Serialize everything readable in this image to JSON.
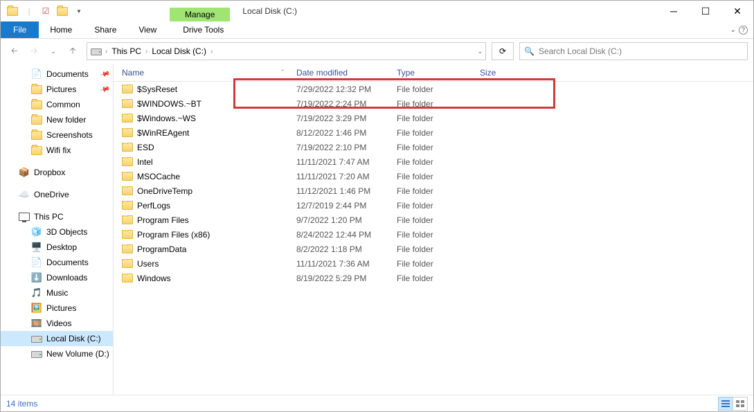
{
  "window": {
    "manage_tab": "Manage",
    "drive_tools": "Drive Tools",
    "title": "Local Disk (C:)"
  },
  "ribbon": {
    "file": "File",
    "home": "Home",
    "share": "Share",
    "view": "View"
  },
  "address": {
    "seg1": "This PC",
    "seg2": "Local Disk (C:)"
  },
  "search": {
    "placeholder": "Search Local Disk (C:)"
  },
  "navpane": {
    "quick": [
      {
        "label": "Documents",
        "icon": "doc",
        "pinned": true
      },
      {
        "label": "Pictures",
        "icon": "folder",
        "pinned": true
      },
      {
        "label": "Common",
        "icon": "folder"
      },
      {
        "label": "New folder",
        "icon": "folder"
      },
      {
        "label": "Screenshots",
        "icon": "folder"
      },
      {
        "label": "Wifi fix",
        "icon": "folder"
      }
    ],
    "dropbox": "Dropbox",
    "onedrive": "OneDrive",
    "thispc": "This PC",
    "pcitems": [
      {
        "label": "3D Objects",
        "icon": "3d"
      },
      {
        "label": "Desktop",
        "icon": "desktop"
      },
      {
        "label": "Documents",
        "icon": "doc"
      },
      {
        "label": "Downloads",
        "icon": "down"
      },
      {
        "label": "Music",
        "icon": "music"
      },
      {
        "label": "Pictures",
        "icon": "pic"
      },
      {
        "label": "Videos",
        "icon": "vid"
      },
      {
        "label": "Local Disk (C:)",
        "icon": "hdd",
        "selected": true
      },
      {
        "label": "New Volume (D:)",
        "icon": "hdd"
      }
    ]
  },
  "columns": {
    "name": "Name",
    "date": "Date modified",
    "type": "Type",
    "size": "Size"
  },
  "files": [
    {
      "name": "$SysReset",
      "date": "7/29/2022 12:32 PM",
      "type": "File folder"
    },
    {
      "name": "$WINDOWS.~BT",
      "date": "7/19/2022 2:24 PM",
      "type": "File folder"
    },
    {
      "name": "$Windows.~WS",
      "date": "7/19/2022 3:29 PM",
      "type": "File folder"
    },
    {
      "name": "$WinREAgent",
      "date": "8/12/2022 1:46 PM",
      "type": "File folder"
    },
    {
      "name": "ESD",
      "date": "7/19/2022 2:10 PM",
      "type": "File folder"
    },
    {
      "name": "Intel",
      "date": "11/11/2021 7:47 AM",
      "type": "File folder"
    },
    {
      "name": "MSOCache",
      "date": "11/11/2021 7:20 AM",
      "type": "File folder"
    },
    {
      "name": "OneDriveTemp",
      "date": "11/12/2021 1:46 PM",
      "type": "File folder"
    },
    {
      "name": "PerfLogs",
      "date": "12/7/2019 2:44 PM",
      "type": "File folder"
    },
    {
      "name": "Program Files",
      "date": "9/7/2022 1:20 PM",
      "type": "File folder"
    },
    {
      "name": "Program Files (x86)",
      "date": "8/24/2022 12:44 PM",
      "type": "File folder"
    },
    {
      "name": "ProgramData",
      "date": "8/2/2022 1:18 PM",
      "type": "File folder"
    },
    {
      "name": "Users",
      "date": "11/11/2021 7:36 AM",
      "type": "File folder"
    },
    {
      "name": "Windows",
      "date": "8/19/2022 5:29 PM",
      "type": "File folder"
    }
  ],
  "status": {
    "count": "14 items"
  }
}
